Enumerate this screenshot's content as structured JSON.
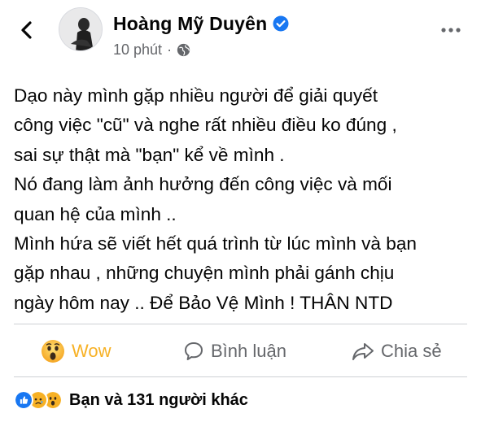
{
  "header": {
    "author_name": "Hoàng Mỹ Duyên",
    "time_ago": "10 phút",
    "separator": "·"
  },
  "post": {
    "text": "Dạo này mình gặp nhiều người để giải quyết\ncông việc \"cũ\" và nghe rất nhiều điều ko đúng ,\nsai sự thật mà \"bạn\" kể về mình .\nNó đang làm ảnh hưởng đến công việc và mối\nquan hệ của mình ..\nMình hứa sẽ viết hết quá trình từ lúc mình và bạn\ngặp nhau , những chuyện mình phải gánh chịu\nngày hôm nay .. Để Bảo Vệ Mình ! THÂN NTD"
  },
  "actions": {
    "reaction_label": "Wow",
    "comment_label": "Bình luận",
    "share_label": "Chia sẻ"
  },
  "reactions_summary": {
    "text": "Bạn và 131 người khác",
    "icons": [
      "like-reaction",
      "sad-reaction",
      "wow-reaction"
    ]
  },
  "colors": {
    "wow_active": "#f7b125",
    "secondary_text": "#65676b",
    "verified_blue": "#1877f2"
  }
}
